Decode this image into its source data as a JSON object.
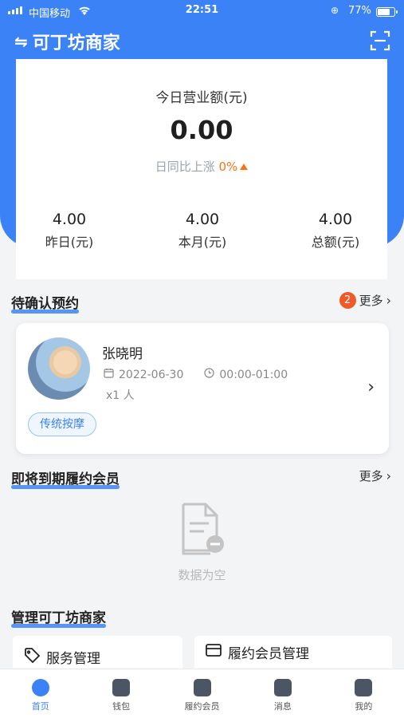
{
  "status_bar": {
    "carrier": "中国移动",
    "time": "22:51",
    "battery": "77%"
  },
  "header": {
    "title": "可丁坊商家",
    "scan_icon": "scan-icon",
    "swap_icon": "swap-icon",
    "brand_color": "#3b82f6"
  },
  "summary": {
    "label": "今日营业额(元)",
    "amount": "0.00",
    "compare_label": "日同比上涨",
    "compare_value": "0%",
    "stats": [
      {
        "value": "4.00",
        "label": "昨日(元)"
      },
      {
        "value": "4.00",
        "label": "本月(元)"
      },
      {
        "value": "4.00",
        "label": "总额(元)"
      }
    ]
  },
  "pending": {
    "title": "待确认预约",
    "badge": "2",
    "more": "更多",
    "item": {
      "name": "张晓明",
      "date": "2022-06-30",
      "time": "00:00-01:00",
      "people": "x1 人",
      "tag": "传统按摩"
    }
  },
  "expiring": {
    "title": "即将到期履约会员",
    "more": "更多",
    "empty": "数据为空"
  },
  "manage": {
    "title": "管理可丁坊商家",
    "cards": [
      {
        "label": "服务管理"
      },
      {
        "label": "履约会员管理"
      }
    ]
  },
  "tabs": [
    {
      "label": "首页",
      "icon": "dashboard-icon"
    },
    {
      "label": "钱包",
      "icon": "wallet-icon"
    },
    {
      "label": "履约会员",
      "icon": "members-icon"
    },
    {
      "label": "消息",
      "icon": "message-icon"
    },
    {
      "label": "我的",
      "icon": "profile-icon"
    }
  ]
}
